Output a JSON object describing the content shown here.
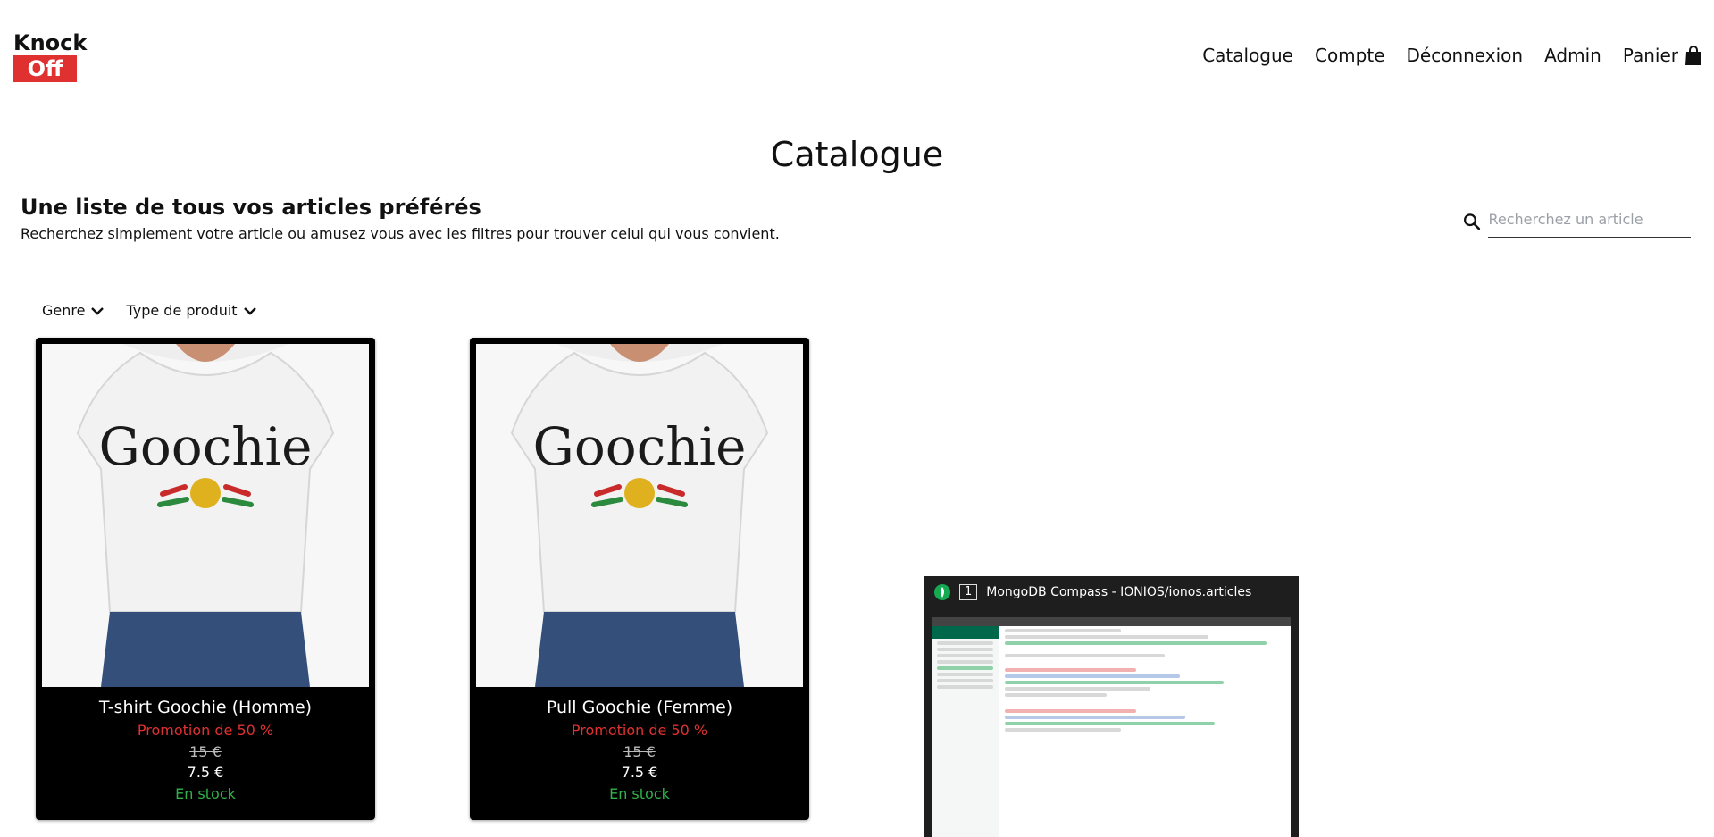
{
  "brand": {
    "line1": "Knock",
    "line2": "Off"
  },
  "nav": {
    "catalogue": "Catalogue",
    "compte": "Compte",
    "deconnexion": "Déconnexion",
    "admin": "Admin",
    "panier": "Panier"
  },
  "page": {
    "title": "Catalogue",
    "heading": "Une liste de tous vos articles préférés",
    "subheading": "Recherchez simplement votre article ou amusez vous avec les filtres pour trouver celui qui vous convient."
  },
  "search": {
    "placeholder": "Recherchez un article",
    "value": ""
  },
  "filters": [
    {
      "label": "Genre"
    },
    {
      "label": "Type de produit"
    }
  ],
  "products": [
    {
      "name": "T-shirt Goochie (Homme)",
      "promo": "Promotion de 50 %",
      "old_price": "15 €",
      "price": "7.5 €",
      "stock": "En stock",
      "print_text": "Goochie"
    },
    {
      "name": "Pull Goochie (Femme)",
      "promo": "Promotion de 50 %",
      "old_price": "15 €",
      "price": "7.5 €",
      "stock": "En stock",
      "print_text": "Goochie"
    }
  ],
  "overlay": {
    "index": "1",
    "title": "MongoDB Compass - IONIOS/ionos.articles"
  },
  "colors": {
    "brand_red": "#e03131",
    "stock_green": "#2fb34a",
    "card_bg": "#000000"
  }
}
